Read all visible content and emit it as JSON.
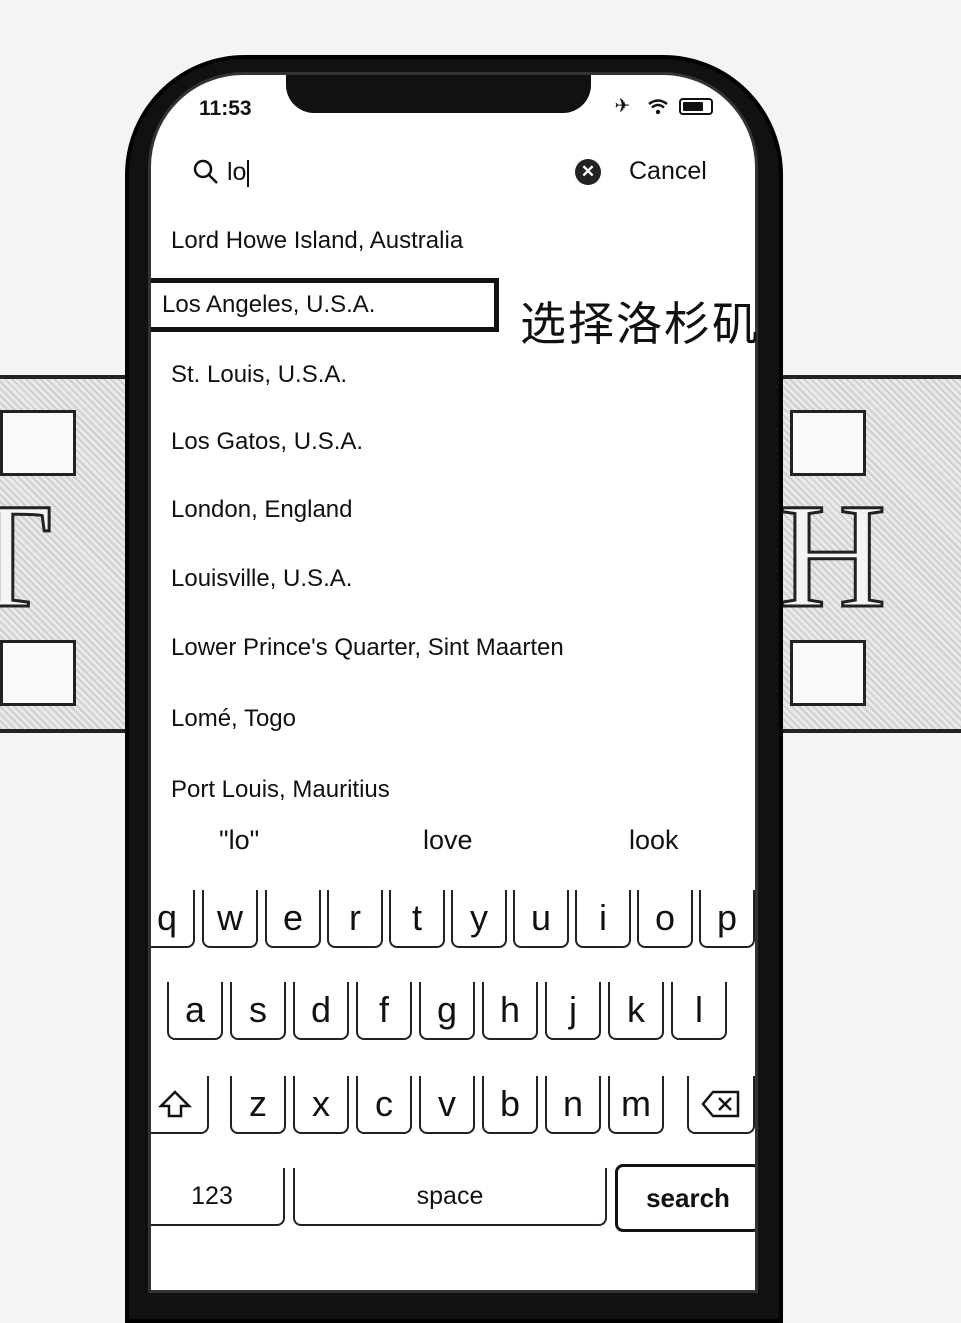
{
  "status": {
    "time": "11:53"
  },
  "search": {
    "query": "lo",
    "cancel_label": "Cancel"
  },
  "results": [
    "Lord Howe Island, Australia",
    "Los Angeles, U.S.A.",
    "St. Louis, U.S.A.",
    "Los Gatos, U.S.A.",
    "London, England",
    "Louisville, U.S.A.",
    "Lower Prince's Quarter, Sint Maarten",
    "Lomé, Togo",
    "Port Louis, Mauritius"
  ],
  "selected_index": 1,
  "annotation": "选择洛杉矶",
  "suggestions": [
    "\"lo\"",
    "love",
    "look"
  ],
  "keyboard": {
    "row1": [
      "q",
      "w",
      "e",
      "r",
      "t",
      "y",
      "u",
      "i",
      "o",
      "p"
    ],
    "row2": [
      "a",
      "s",
      "d",
      "f",
      "g",
      "h",
      "j",
      "k",
      "l"
    ],
    "row3": [
      "z",
      "x",
      "c",
      "v",
      "b",
      "n",
      "m"
    ],
    "num_label": "123",
    "space_label": "space",
    "search_label": "search",
    "shift_icon": "shift-icon",
    "delete_icon": "delete-icon"
  },
  "background": {
    "left_text": "T",
    "right_text": "H"
  }
}
